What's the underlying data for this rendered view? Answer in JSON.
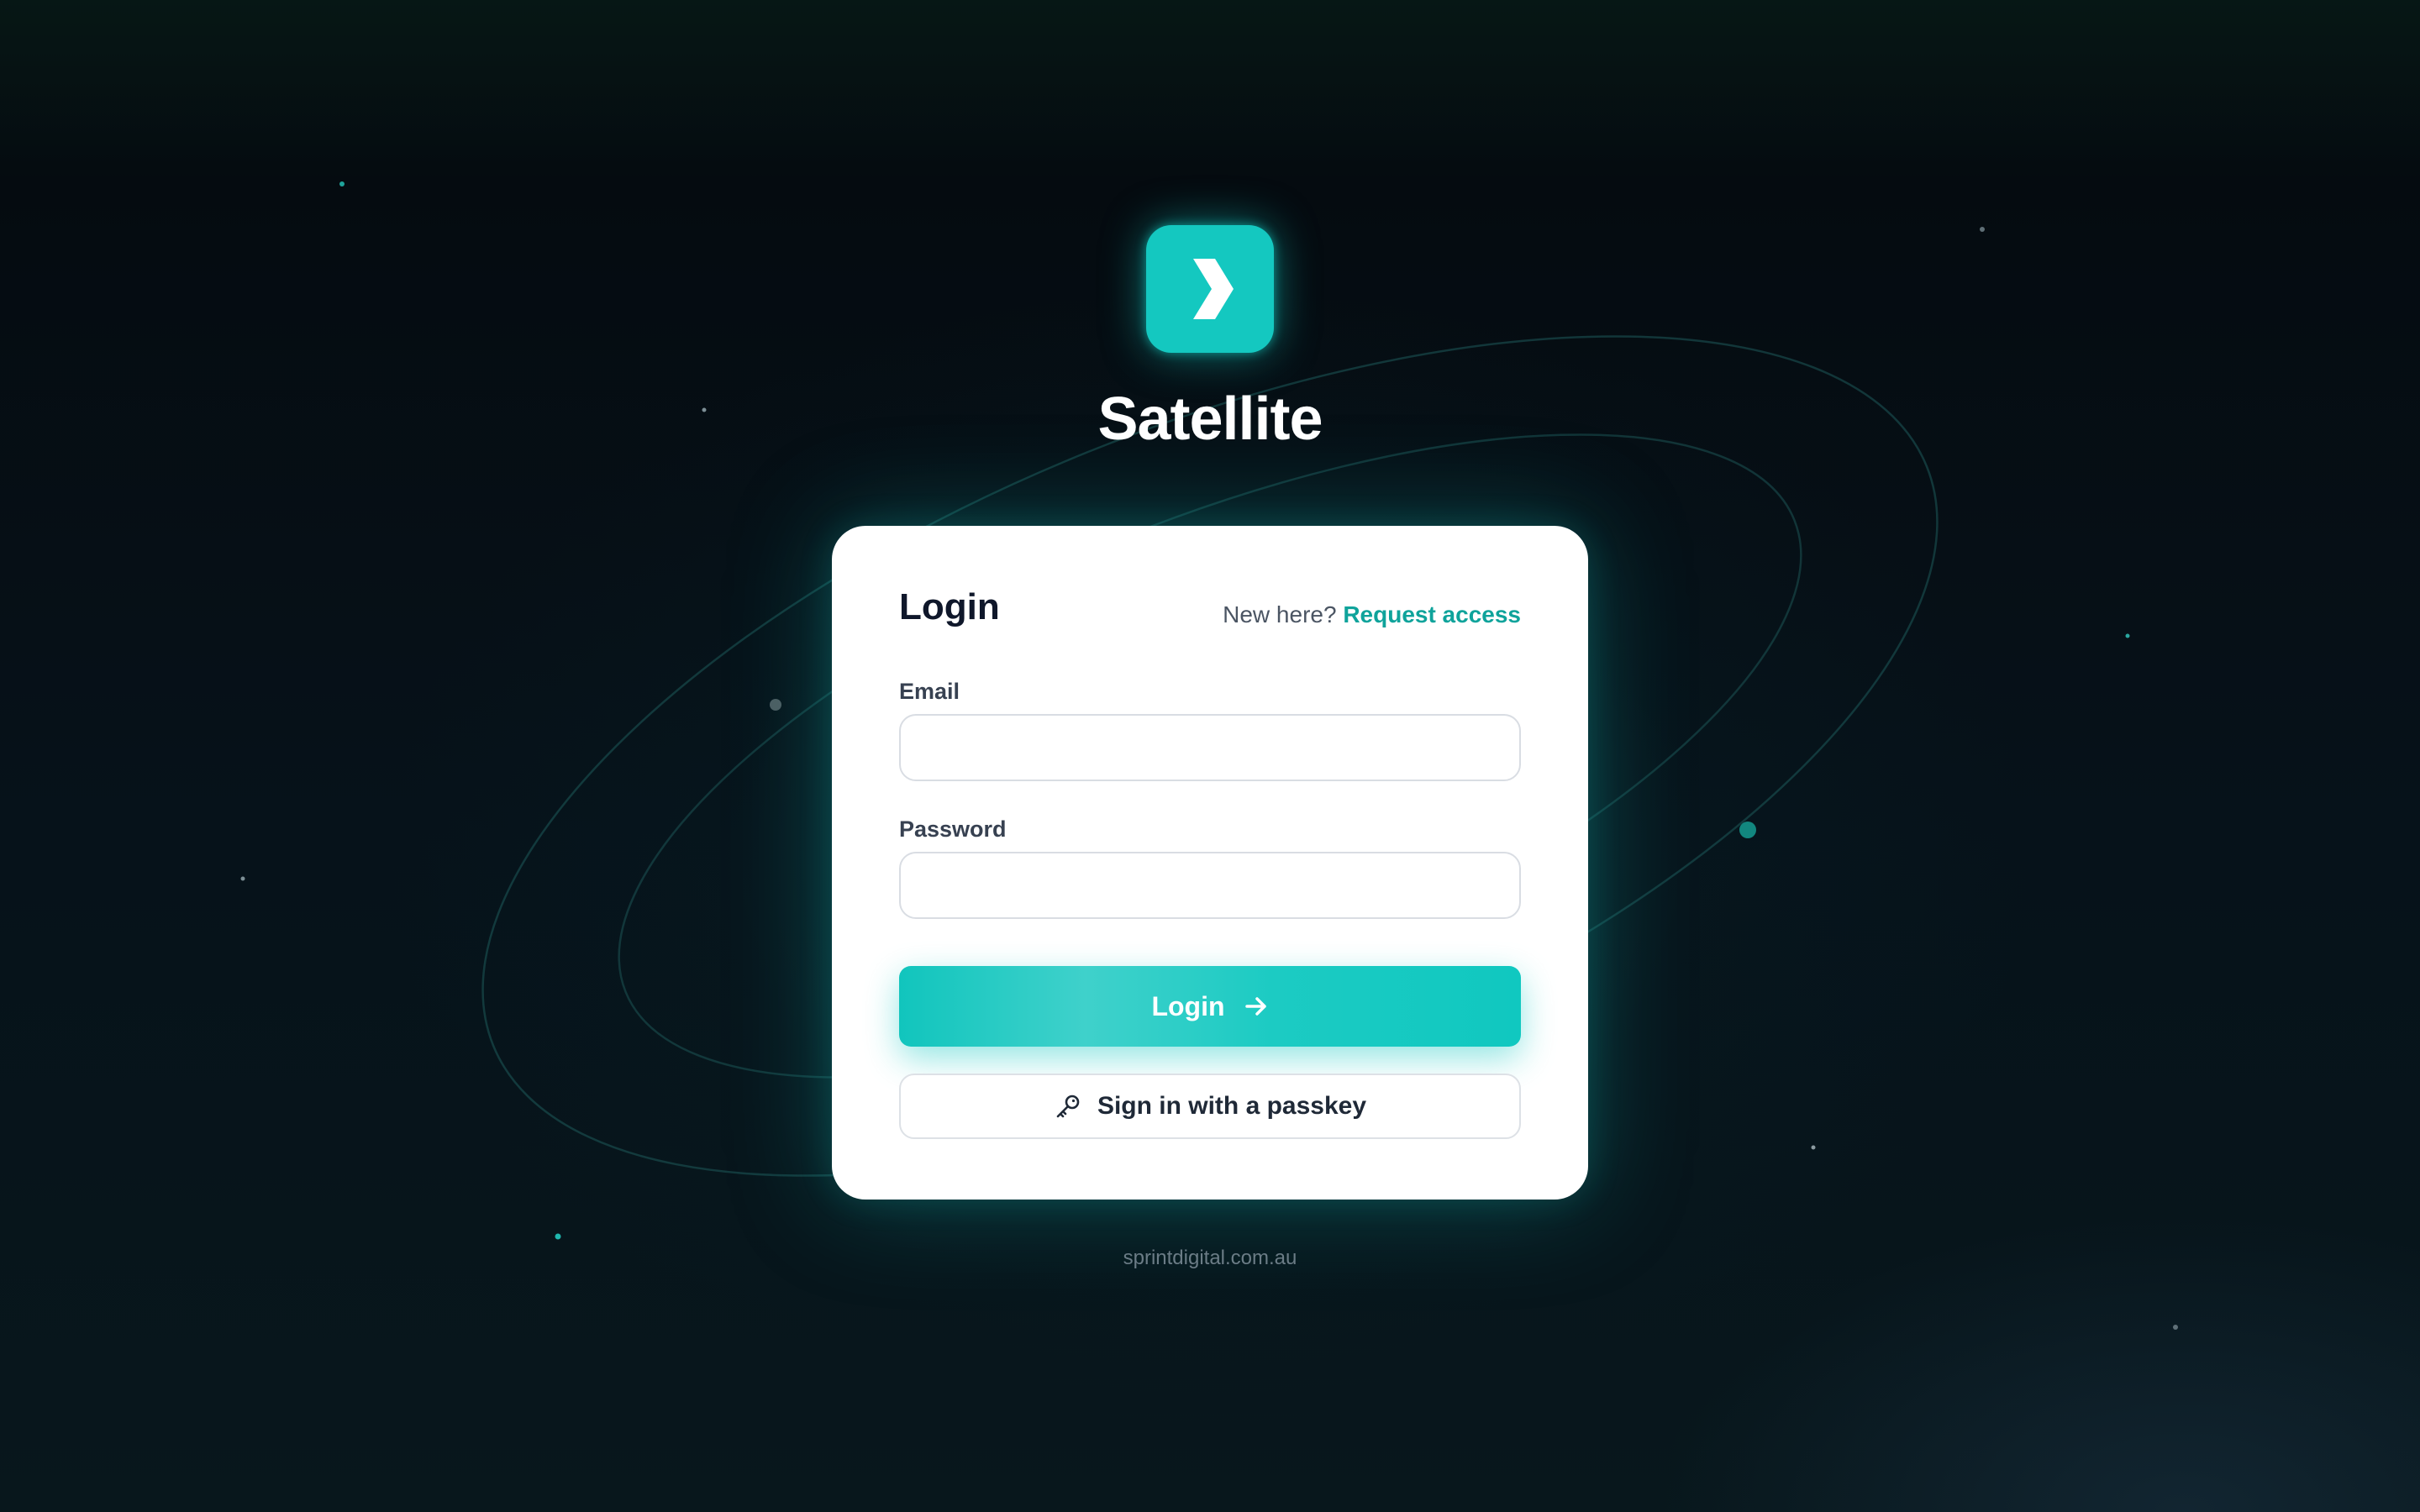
{
  "brand": {
    "app_name": "Satellite",
    "logo_glyph": "❯",
    "logo_icon": "chevron-right-icon",
    "accent_color": "#14c8c0"
  },
  "login_card": {
    "title": "Login",
    "signup_prompt": "New here?",
    "signup_link": "Request access",
    "email_label": "Email",
    "email_value": "",
    "password_label": "Password",
    "password_value": "",
    "login_button": "Login",
    "login_button_icon": "arrow-right-icon",
    "passkey_button": "Sign in with a passkey",
    "passkey_button_icon": "key-icon"
  },
  "footer": {
    "domain": "sprintdigital.com.au"
  }
}
